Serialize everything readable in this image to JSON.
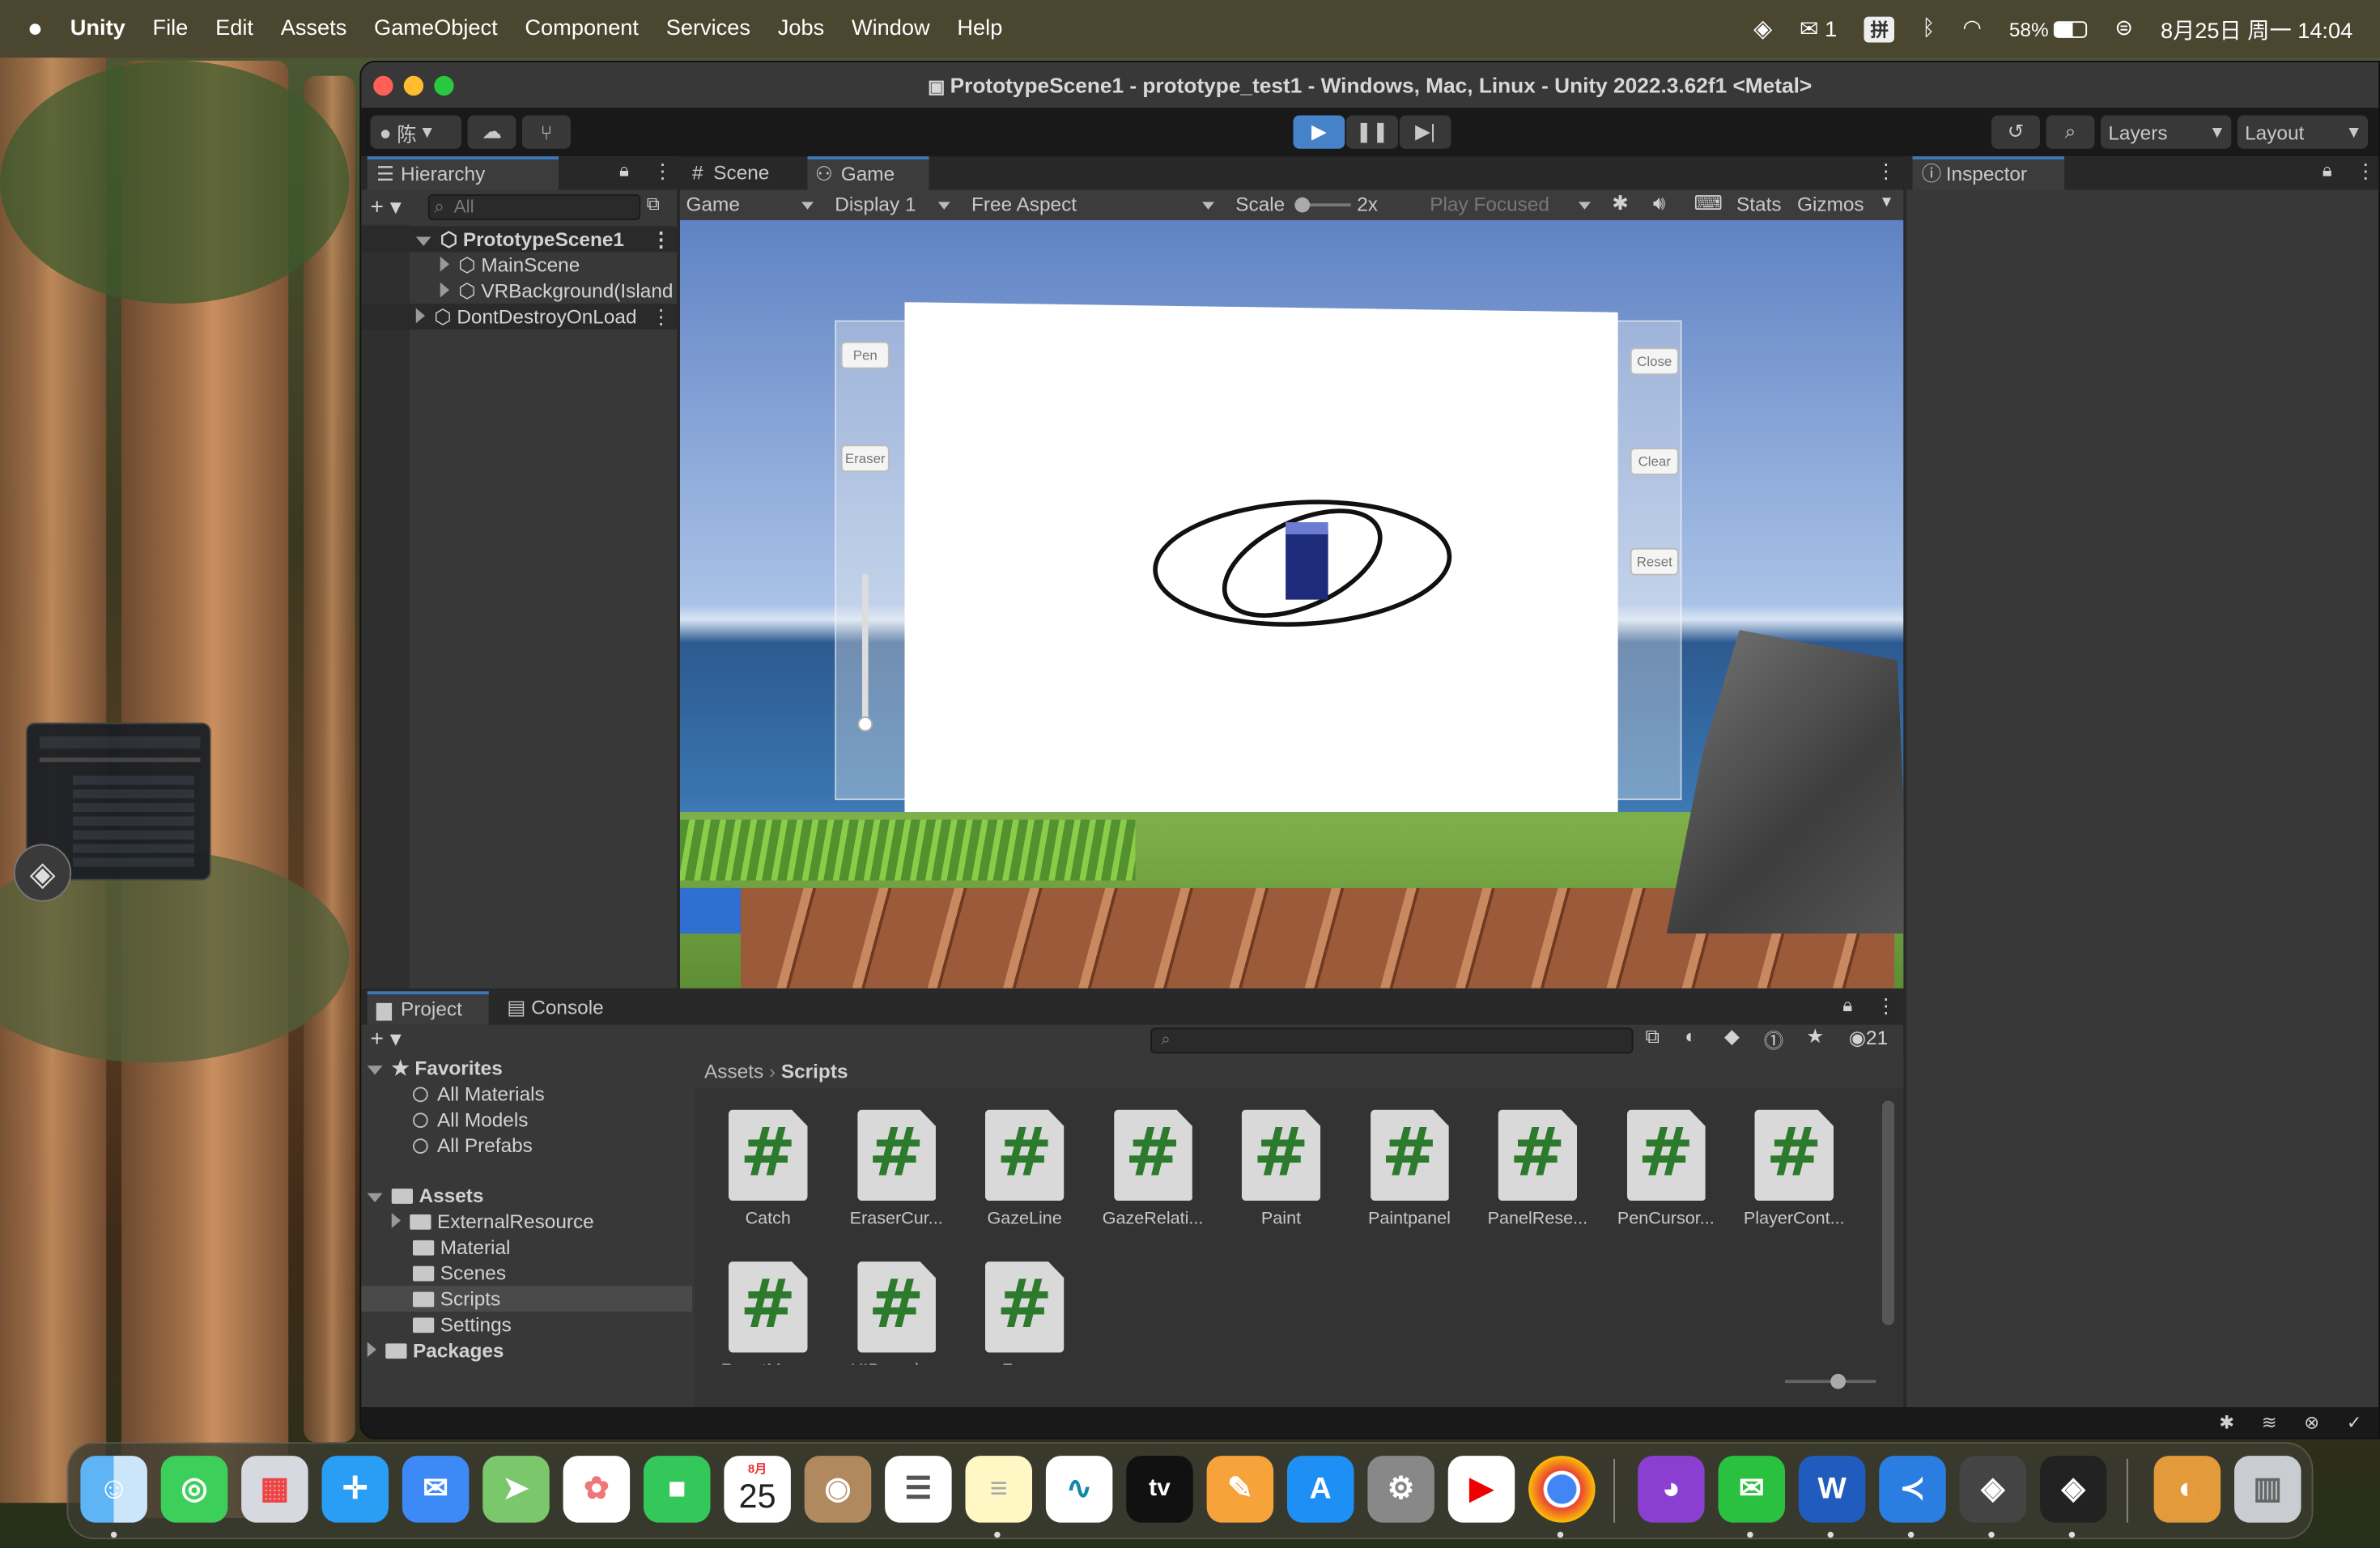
{
  "menubar": {
    "app": "Unity",
    "items": [
      "File",
      "Edit",
      "Assets",
      "GameObject",
      "Component",
      "Services",
      "Jobs",
      "Window",
      "Help"
    ],
    "wechat_count": "1",
    "input_method": "拼",
    "battery": "58%",
    "datetime": "8月25日 周一 14:04"
  },
  "window": {
    "title": "PrototypeScene1 - prototype_test1 - Windows, Mac, Linux - Unity 2022.3.62f1 <Metal>",
    "account_label": "陈",
    "layers_label": "Layers",
    "layout_label": "Layout"
  },
  "hierarchy": {
    "tab": "Hierarchy",
    "search_placeholder": "All",
    "items": [
      {
        "label": "PrototypeScene1"
      },
      {
        "label": "MainScene"
      },
      {
        "label": "VRBackground(Island"
      },
      {
        "label": "DontDestroyOnLoad"
      }
    ]
  },
  "game_view": {
    "tabs": [
      "Scene",
      "Game"
    ],
    "mode": "Game",
    "display": "Display 1",
    "aspect": "Free Aspect",
    "scale_label": "Scale",
    "scale_value": "2x",
    "play_mode": "Play Focused",
    "stats": "Stats",
    "gizmos": "Gizmos",
    "left_buttons": [
      "Pen",
      "Eraser"
    ],
    "right_buttons": [
      "Close",
      "Clear",
      "Reset"
    ]
  },
  "inspector": {
    "tab": "Inspector"
  },
  "project": {
    "tabs": [
      "Project",
      "Console"
    ],
    "hidden_count": "21",
    "favorites": {
      "label": "Favorites",
      "items": [
        "All Materials",
        "All Models",
        "All Prefabs"
      ]
    },
    "assets": {
      "label": "Assets",
      "items": [
        "ExternalResource",
        "Material",
        "Scenes",
        "Scripts",
        "Settings"
      ]
    },
    "packages": "Packages",
    "breadcrumb": [
      "Assets",
      "Scripts"
    ],
    "scripts": [
      "Catch",
      "EraserCur...",
      "GazeLine",
      "GazeRelati...",
      "Paint",
      "Paintpanel",
      "PanelRese...",
      "PenCursor...",
      "PlayerCont...",
      "ResetMan...",
      "UIBounds...",
      "Zoom"
    ],
    "script_glyph": "#"
  },
  "dock": {
    "calendar_month": "8月",
    "calendar_day": "25",
    "tv_label": "tv"
  }
}
